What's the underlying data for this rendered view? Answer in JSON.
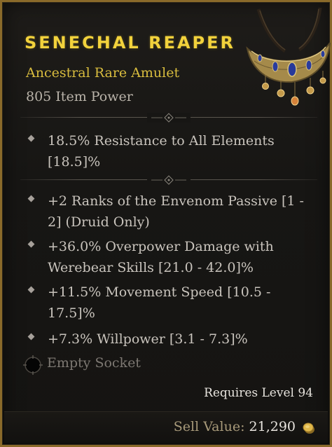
{
  "item": {
    "name": "SENECHAL REAPER",
    "type": "Ancestral Rare Amulet",
    "item_power": "805 Item Power",
    "implicit_affixes": [
      {
        "text": "18.5% Resistance to All Elements [18.5]%"
      }
    ],
    "affixes": [
      {
        "text": "+2 Ranks of the Envenom Passive [1 - 2] (Druid Only)"
      },
      {
        "text": "+36.0% Overpower Damage with Werebear Skills [21.0 - 42.0]%"
      },
      {
        "text": "+11.5% Movement Speed [10.5 - 17.5]%"
      },
      {
        "text": "+7.3% Willpower [3.1 - 7.3]%"
      }
    ],
    "socket": "Empty Socket",
    "requirement": "Requires Level 94",
    "sell_label": "Sell Value:",
    "sell_amount": "21,290"
  },
  "colors": {
    "rare_title": "#f2d23c",
    "rare_type": "#d8bc3e",
    "affix_text": "#c9c4bd",
    "border_gold": "#8a6a2a"
  },
  "icons": {
    "item_art": "amulet-icon",
    "socket": "socket-icon",
    "currency": "gold-coin-icon",
    "bullet": "diamond-bullet-icon"
  }
}
